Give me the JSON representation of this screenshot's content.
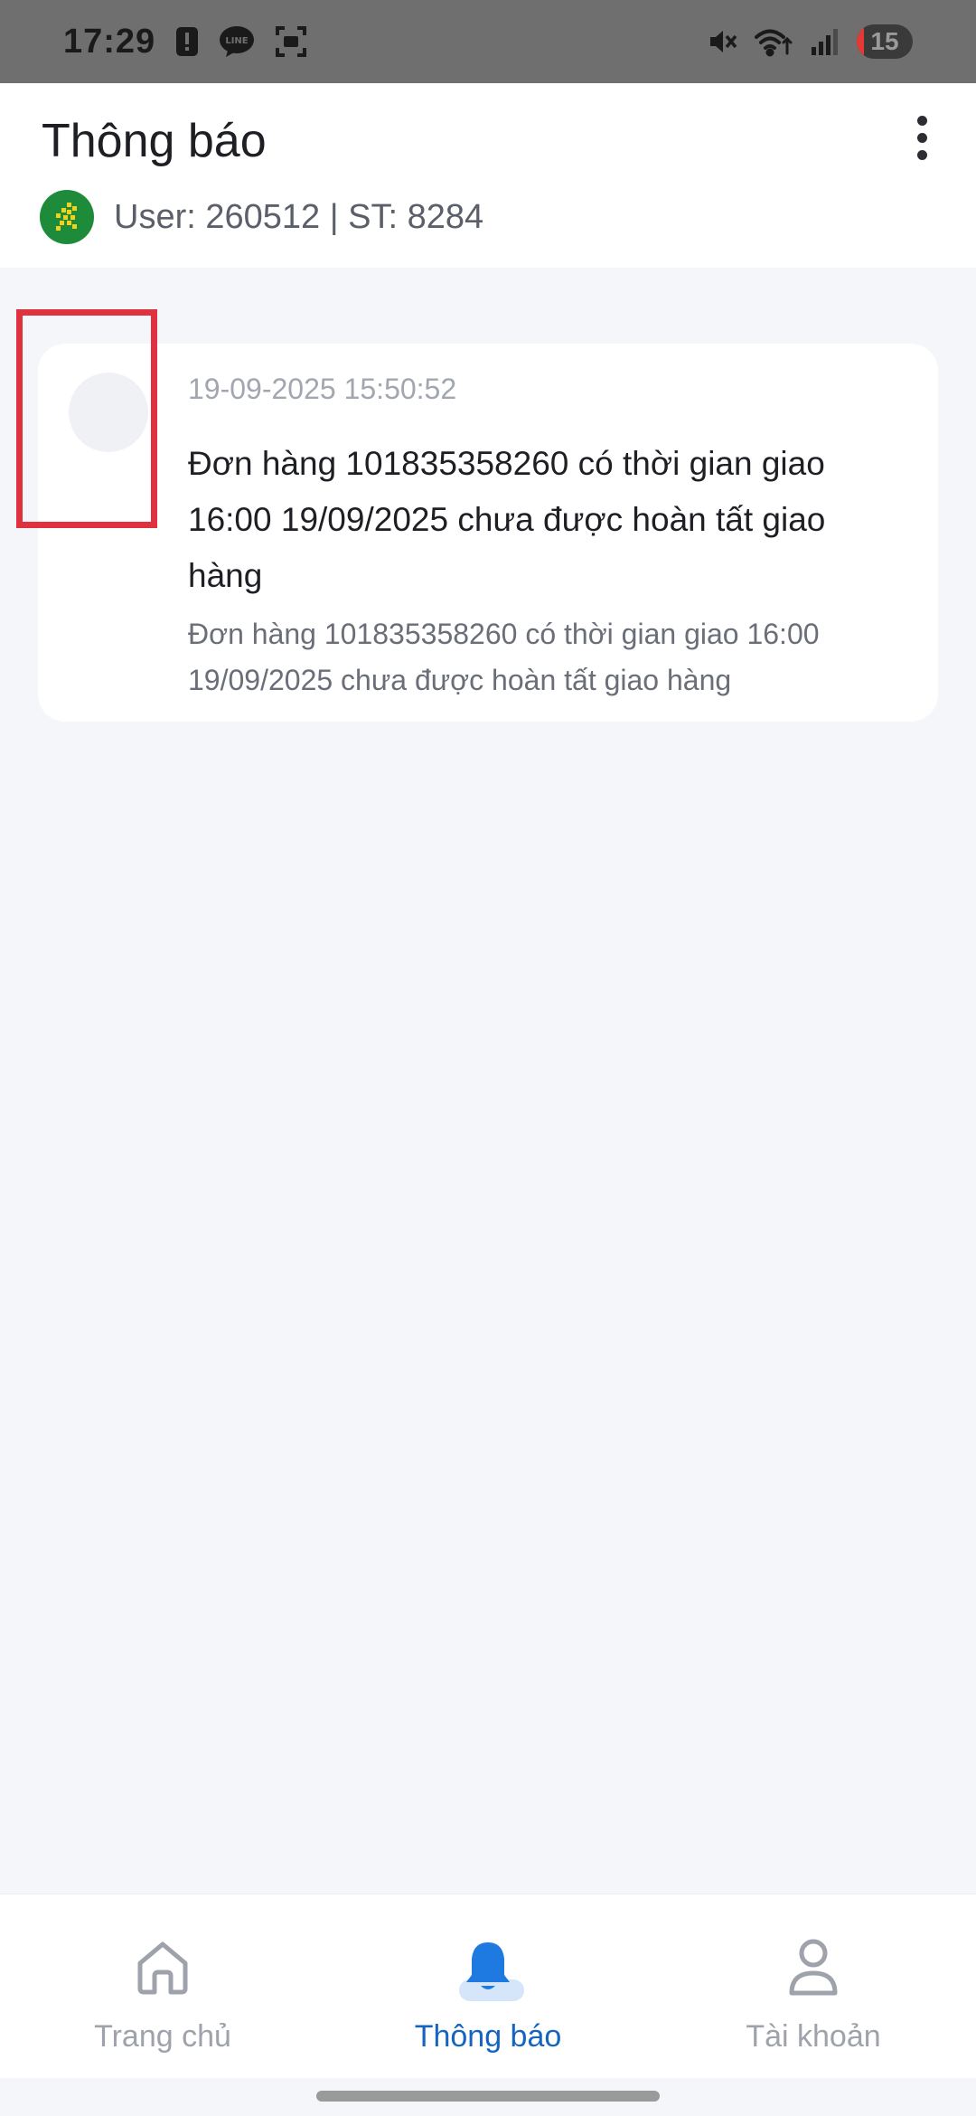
{
  "status_bar": {
    "time": "17:29",
    "battery": "15",
    "icons": [
      "alert-icon",
      "line-app-icon",
      "screenshot-icon",
      "mute-icon",
      "wifi-icon",
      "signal-icon",
      "battery-icon"
    ]
  },
  "header": {
    "title": "Thông báo",
    "user_info": "User: 260512 | ST: 8284"
  },
  "notifications": [
    {
      "time": "19-09-2025 15:50:52",
      "title": "Đơn hàng 101835358260 có thời gian giao 16:00 19/09/2025 chưa được hoàn tất giao hàng",
      "body": "Đơn hàng 101835358260 có thời gian giao 16:00 19/09/2025 chưa được hoàn tất giao hàng"
    }
  ],
  "bottom_nav": {
    "items": [
      {
        "label": "Trang chủ",
        "icon": "home-icon",
        "active": false
      },
      {
        "label": "Thông báo",
        "icon": "bell-icon",
        "active": true
      },
      {
        "label": "Tài khoản",
        "icon": "user-icon",
        "active": false
      }
    ]
  },
  "colors": {
    "accent": "#1565c0",
    "highlight": "#e0313f",
    "background": "#f5f6fa"
  }
}
